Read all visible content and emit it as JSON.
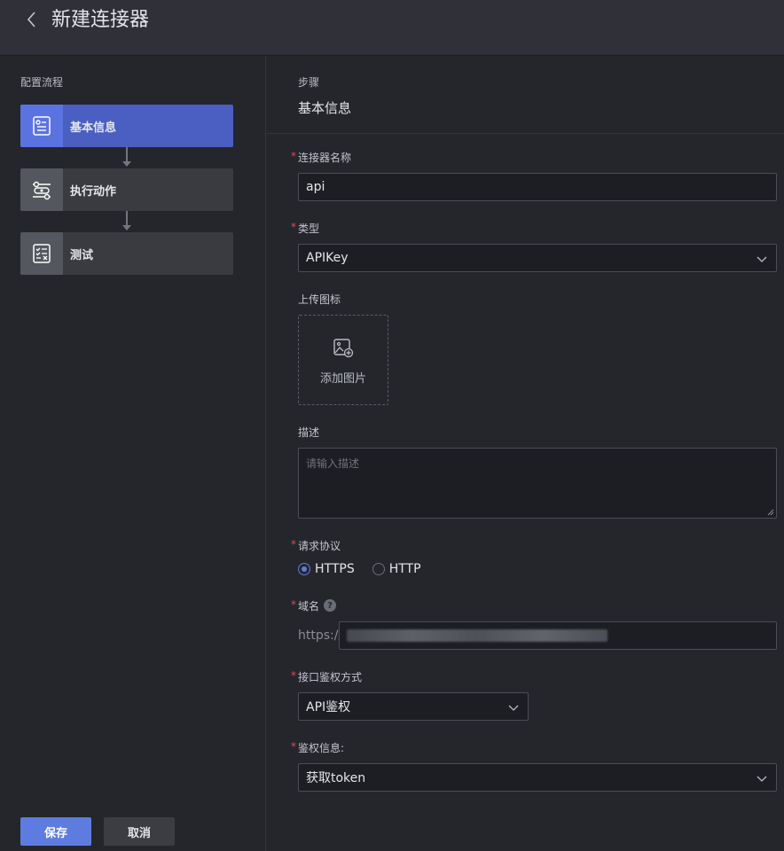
{
  "header": {
    "title": "新建连接器"
  },
  "sidebar": {
    "flow_label": "配置流程",
    "steps": [
      {
        "label": "基本信息",
        "active": true,
        "icon": "form-icon"
      },
      {
        "label": "执行动作",
        "active": false,
        "icon": "action-icon"
      },
      {
        "label": "测试",
        "active": false,
        "icon": "test-checklist-icon"
      }
    ],
    "save_label": "保存",
    "cancel_label": "取消"
  },
  "main": {
    "step_caption": "步骤",
    "step_name": "基本信息",
    "fields": {
      "connector_name": {
        "label": "连接器名称",
        "value": "api"
      },
      "type": {
        "label": "类型",
        "value": "APIKey"
      },
      "upload_icon": {
        "label": "上传图标",
        "button": "添加图片"
      },
      "description": {
        "label": "描述",
        "placeholder": "请输入描述"
      },
      "protocol": {
        "label": "请求协议",
        "options": [
          "HTTPS",
          "HTTP"
        ],
        "selected": "HTTPS"
      },
      "domain": {
        "label": "域名",
        "prefix": "https://",
        "help": "?"
      },
      "auth_method": {
        "label": "接口鉴权方式",
        "value": "API鉴权"
      },
      "auth_info": {
        "label": "鉴权信息:",
        "value": "获取token"
      }
    },
    "required_mark": "*"
  },
  "colors": {
    "accent": "#5e7ce0",
    "active_step": "#4a5fc1",
    "required": "#e5484d"
  }
}
